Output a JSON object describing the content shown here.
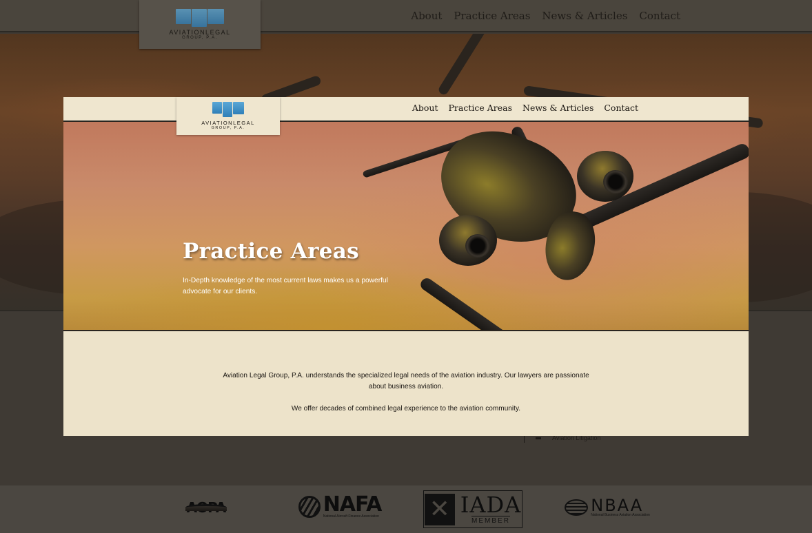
{
  "brand": {
    "name": "AVIATIONLEGAL",
    "subname": "GROUP, P.A.",
    "accent": "#3b8fc8"
  },
  "nav": {
    "items": [
      {
        "label": "About"
      },
      {
        "label": "Practice Areas"
      },
      {
        "label": "News & Articles"
      },
      {
        "label": "Contact"
      }
    ]
  },
  "hero": {
    "title": "Practice Areas",
    "subtitle": "In-Depth knowledge of the most current laws makes us a powerful advocate for our clients."
  },
  "intro": {
    "paragraph1": "Aviation Legal Group, P.A. understands the specialized legal needs of the aviation industry. Our lawyers are passionate about business aviation.",
    "paragraph2": "We offer decades of combined legal experience to the aviation community."
  },
  "background": {
    "list_item": "Aviation Litigation"
  },
  "partners": {
    "aopa": {
      "mark": "AOPA"
    },
    "nafa": {
      "mark": "NAFA",
      "tagline": "National Aircraft Finance Association"
    },
    "iada": {
      "mark": "IADA",
      "tagline": "MEMBER"
    },
    "nbaa": {
      "mark": "NBAA",
      "tagline": "National Business Aviation Association"
    }
  },
  "colors": {
    "card_bg": "#ede3ca",
    "overlay": "#3f3a34"
  }
}
